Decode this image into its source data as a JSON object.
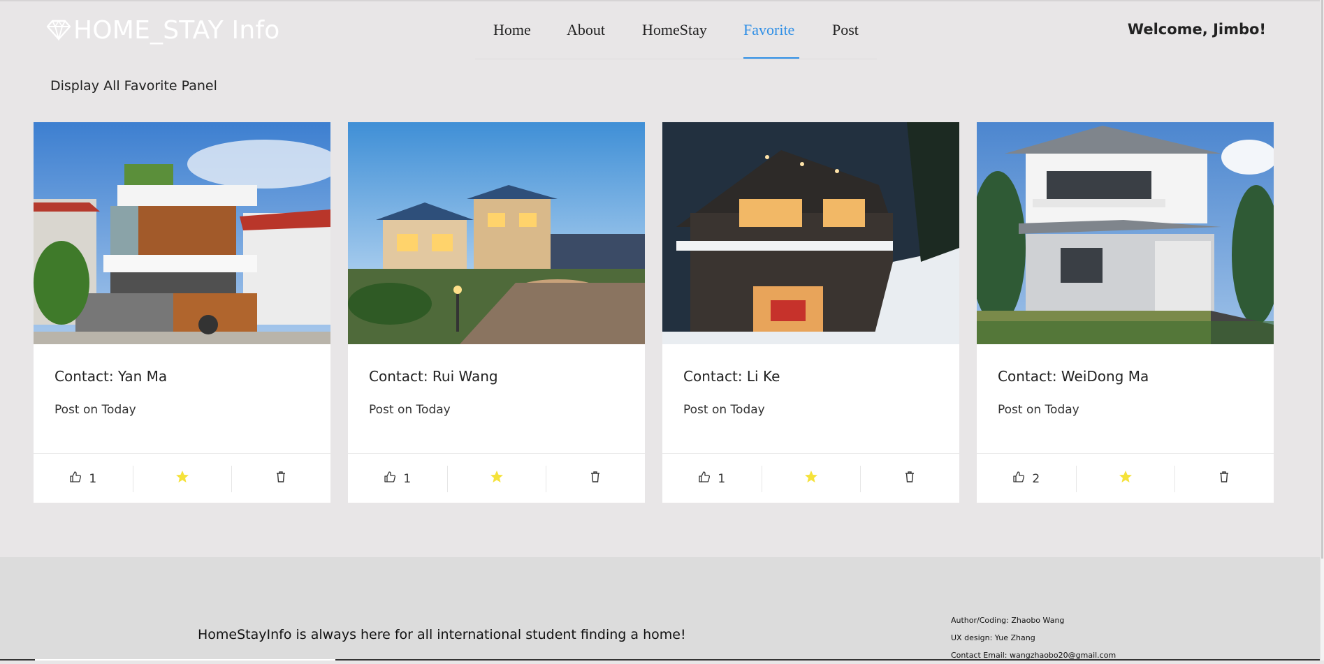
{
  "brand": {
    "name": "HOME_STAY Info",
    "icon": "diamond-icon"
  },
  "nav": {
    "items": [
      {
        "label": "Home",
        "active": false
      },
      {
        "label": "About",
        "active": false
      },
      {
        "label": "HomeStay",
        "active": false
      },
      {
        "label": "Favorite",
        "active": true
      },
      {
        "label": "Post",
        "active": false
      }
    ]
  },
  "user": {
    "welcome": "Welcome, Jimbo!"
  },
  "panel": {
    "title": "Display All Favorite Panel"
  },
  "cards": [
    {
      "contact": "Contact: Yan Ma",
      "posted": "Post on Today",
      "likes": "1",
      "image": "modern-house-photo"
    },
    {
      "contact": "Contact: Rui Wang",
      "posted": "Post on Today",
      "likes": "1",
      "image": "evening-villa-photo"
    },
    {
      "contact": "Contact: Li Ke",
      "posted": "Post on Today",
      "likes": "1",
      "image": "snowy-house-photo"
    },
    {
      "contact": "Contact: WeiDong Ma",
      "posted": "Post on Today",
      "likes": "2",
      "image": "two-storey-house-photo"
    }
  ],
  "footer": {
    "tagline": "HomeStayInfo is always here for all international student finding a home!",
    "credits": [
      "Author/Coding: Zhaobo Wang",
      "UX design: Yue Zhang",
      "Contact Email: wangzhaobo20@gmail.com"
    ]
  },
  "colors": {
    "accent": "#2f8fe6",
    "star": "#f5e23a",
    "background": "#e8e6e7",
    "footer": "#dcdcdc"
  }
}
